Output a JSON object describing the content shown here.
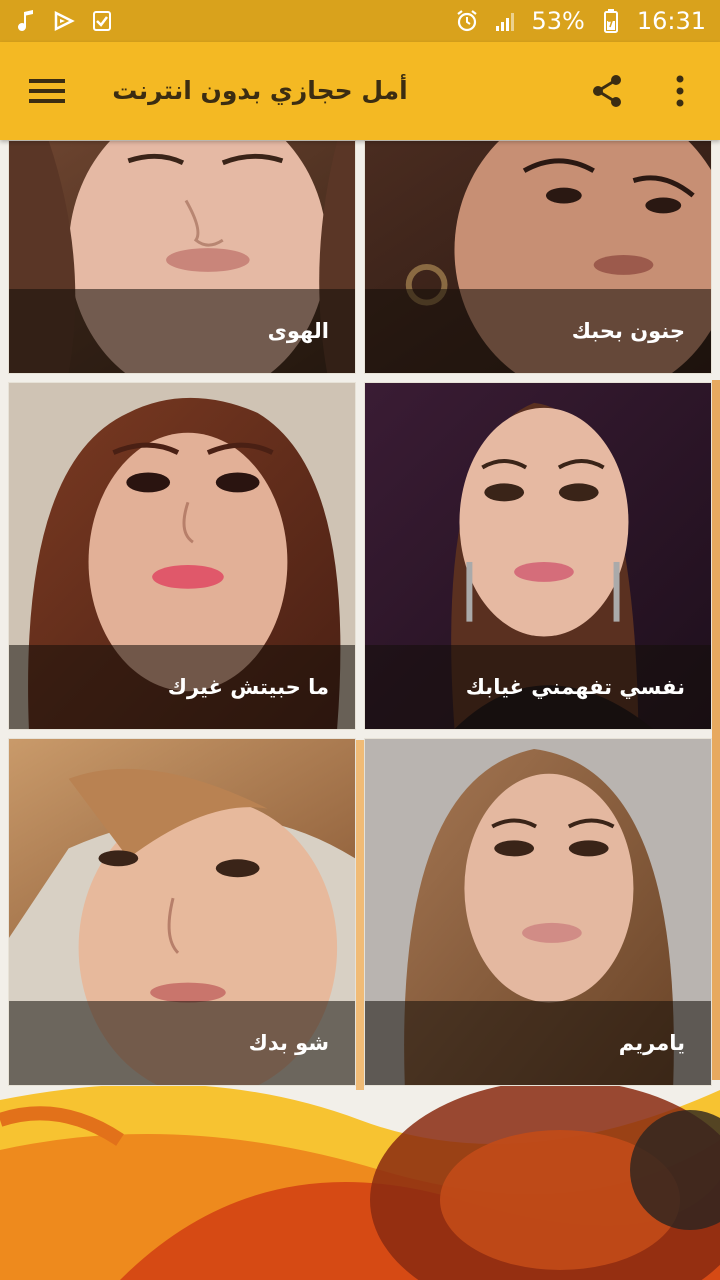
{
  "status_bar": {
    "battery_percent": "53%",
    "time": "16:31",
    "left_icons": [
      "music-note-icon",
      "media-play-icon",
      "checkbox-icon"
    ],
    "right_icons": [
      "alarm-icon",
      "signal-icon",
      "battery-icon"
    ]
  },
  "app_bar": {
    "title": "أمل حجازي بدون انترنت",
    "icons": [
      "menu-icon",
      "share-icon",
      "more-vert-icon"
    ]
  },
  "colors": {
    "status_bar": "#d9a21c",
    "app_bar": "#f4b923",
    "title_text": "#3b2d12",
    "caption_overlay": "rgba(20,14,10,0.55)"
  },
  "songs": [
    {
      "title": "الهوى"
    },
    {
      "title": "جنون بحبك"
    },
    {
      "title": "ما حبيتش غيرك"
    },
    {
      "title": "نفسي تفهمني غيابك"
    },
    {
      "title": "شو بدك"
    },
    {
      "title": "يامريم"
    }
  ]
}
